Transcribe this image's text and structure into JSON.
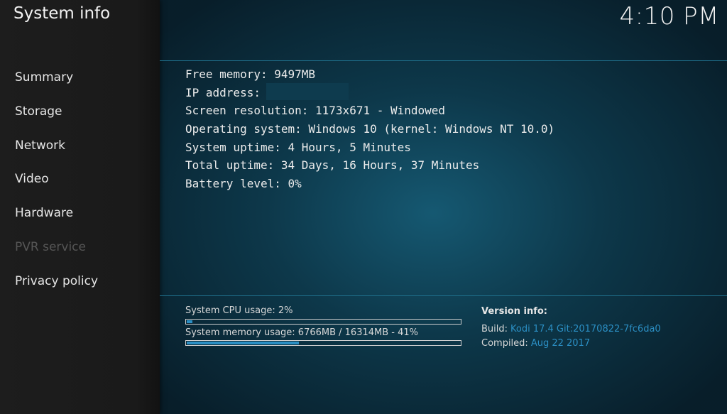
{
  "header": {
    "title": "System info",
    "clock": "4:10 PM"
  },
  "sidebar": {
    "items": [
      {
        "label": "Summary",
        "enabled": true
      },
      {
        "label": "Storage",
        "enabled": true
      },
      {
        "label": "Network",
        "enabled": true
      },
      {
        "label": "Video",
        "enabled": true
      },
      {
        "label": "Hardware",
        "enabled": true
      },
      {
        "label": "PVR service",
        "enabled": false
      },
      {
        "label": "Privacy policy",
        "enabled": true
      }
    ]
  },
  "info": {
    "free_memory": "Free memory: 9497MB",
    "ip_address": "IP address:",
    "screen_resolution": "Screen resolution: 1173x671 - Windowed",
    "operating_system": "Operating system: Windows 10 (kernel: Windows NT 10.0)",
    "system_uptime": "System uptime: 4 Hours, 5 Minutes",
    "total_uptime": "Total uptime: 34 Days, 16 Hours, 37 Minutes",
    "battery_level": "Battery level: 0%"
  },
  "stats": {
    "cpu_label": "System CPU usage: 2%",
    "cpu_percent": 2,
    "memory_label": "System memory usage: 6766MB / 16314MB - 41%",
    "memory_percent": 41
  },
  "version": {
    "title": "Version info:",
    "build_key": "Build:",
    "build_value": "Kodi 17.4 Git:20170822-7fc6da0",
    "compiled_key": "Compiled:",
    "compiled_value": "Aug 22 2017"
  },
  "colors": {
    "accent": "#2b8fc4",
    "disabled": "#565656"
  }
}
